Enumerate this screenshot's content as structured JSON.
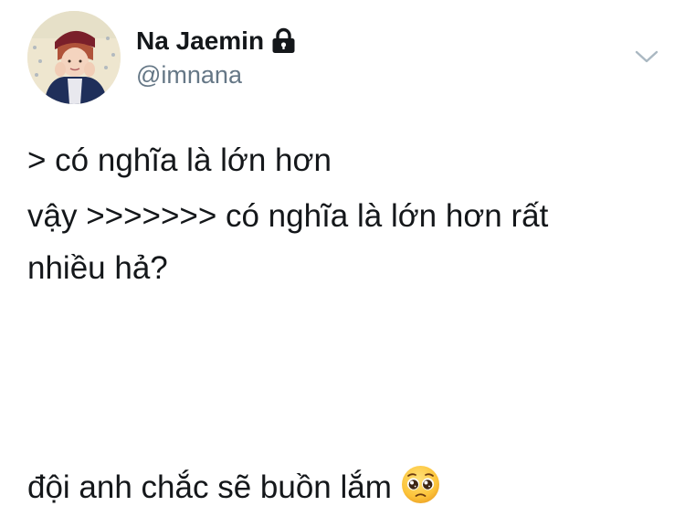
{
  "user": {
    "display_name": "Na Jaemin",
    "handle": "@imnana",
    "avatar_icon": "profile-photo",
    "protected_icon": "lock-icon"
  },
  "menu": {
    "icon": "chevron-down-icon"
  },
  "tweet": {
    "lines": [
      "> có nghĩa là lớn hơn",
      "vậy >>>>>>> có nghĩa là lớn hơn rất",
      "nhiều hả?",
      "đội anh chắc sẽ buồn lắm"
    ],
    "emoji": "pleading-face-emoji"
  },
  "colors": {
    "text": "#14171a",
    "secondary": "#657786",
    "caret": "#aab8c2"
  }
}
